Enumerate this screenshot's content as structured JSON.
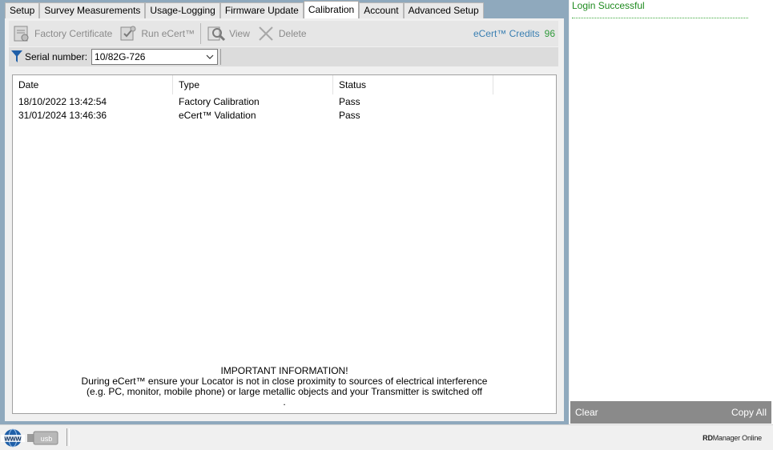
{
  "tabs": [
    {
      "label": "Setup",
      "active": false
    },
    {
      "label": "Survey Measurements",
      "active": false
    },
    {
      "label": "Usage-Logging",
      "active": false
    },
    {
      "label": "Firmware Update",
      "active": false
    },
    {
      "label": "Calibration",
      "active": true
    },
    {
      "label": "Account",
      "active": false
    },
    {
      "label": "Advanced Setup",
      "active": false
    }
  ],
  "toolbar": {
    "factory_certificate": "Factory Certificate",
    "run_ecert": "Run eCert™",
    "view": "View",
    "delete": "Delete",
    "credits_label": "eCert™ Credits",
    "credits_value": "96"
  },
  "serial": {
    "label": "Serial number:",
    "value": "10/82G-726"
  },
  "table": {
    "headers": [
      "Date",
      "Type",
      "Status"
    ],
    "rows": [
      [
        "18/10/2022 13:42:54",
        "Factory Calibration",
        "Pass"
      ],
      [
        "31/01/2024 13:46:36",
        "eCert™ Validation",
        "Pass"
      ]
    ]
  },
  "info": {
    "heading": "IMPORTANT INFORMATION!",
    "line1": "During eCert™ ensure your Locator is not in close proximity to sources of electrical interference",
    "line2": "(e.g. PC, monitor, mobile phone) or large metallic objects and your Transmitter is switched off",
    "line3": "."
  },
  "log": {
    "message": "Login Successful",
    "clear_label": "Clear",
    "copy_all_label": "Copy All"
  },
  "statusbar": {
    "www_label": "www",
    "usb_label": "usb",
    "brand_bold": "RD",
    "brand_rest": "Manager Online"
  },
  "colors": {
    "frame": "#8fa9bd",
    "credits_label": "#3a7fb2",
    "credits_value": "#2f9a3a",
    "log_text": "#1e8a1e",
    "log_footer": "#8a8a8a"
  }
}
